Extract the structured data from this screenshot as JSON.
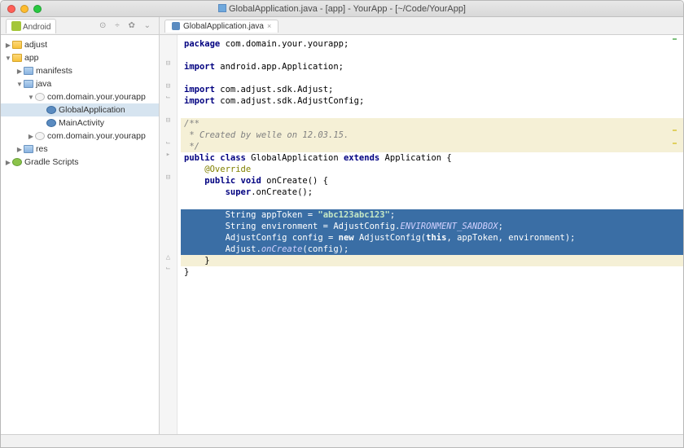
{
  "window": {
    "title_file": "GlobalApplication.java",
    "title_suffix": " - [app] - YourApp - [~/Code/YourApp]"
  },
  "sidebar_header": {
    "label": "Android",
    "icons": "⊙ ÷ ✿ ⌄"
  },
  "editor_tab": {
    "label": "GlobalApplication.java",
    "close": "×"
  },
  "tree": {
    "adjust": "adjust",
    "app": "app",
    "manifests": "manifests",
    "java": "java",
    "pkg1": "com.domain.your.yourapp",
    "global_app": "GlobalApplication",
    "main_activity": "MainActivity",
    "pkg2": "com.domain.your.yourapp",
    "res": "res",
    "gradle": "Gradle Scripts"
  },
  "code": {
    "l1a": "package",
    "l1b": " com.domain.your.yourapp;",
    "l3a": "import",
    "l3b": " android.app.Application;",
    "l5a": "import",
    "l5b": " com.adjust.sdk.Adjust;",
    "l6a": "import",
    "l6b": " com.adjust.sdk.AdjustConfig;",
    "l8": "/**",
    "l9": " * Created by welle on 12.03.15.",
    "l10": " */",
    "l11a": "public class",
    "l11b": " GlobalApplication ",
    "l11c": "extends",
    "l11d": " Application {",
    "l12": "    @Override",
    "l13a": "    public void",
    "l13b": " onCreate() {",
    "l14a": "        super",
    "l14b": ".onCreate();",
    "l16a": "        String appToken = ",
    "l16b": "\"abc123abc123\"",
    "l16c": ";",
    "l17a": "        String environment = AdjustConfig.",
    "l17b": "ENVIRONMENT_SANDBOX",
    "l17c": ";",
    "l18a": "        AdjustConfig config = ",
    "l18b": "new",
    "l18c": " AdjustConfig(",
    "l18d": "this",
    "l18e": ", appToken, environment);",
    "l19a": "        Adjust.",
    "l19b": "onCreate",
    "l19c": "(config);",
    "l20": "    }",
    "l21": "}"
  }
}
